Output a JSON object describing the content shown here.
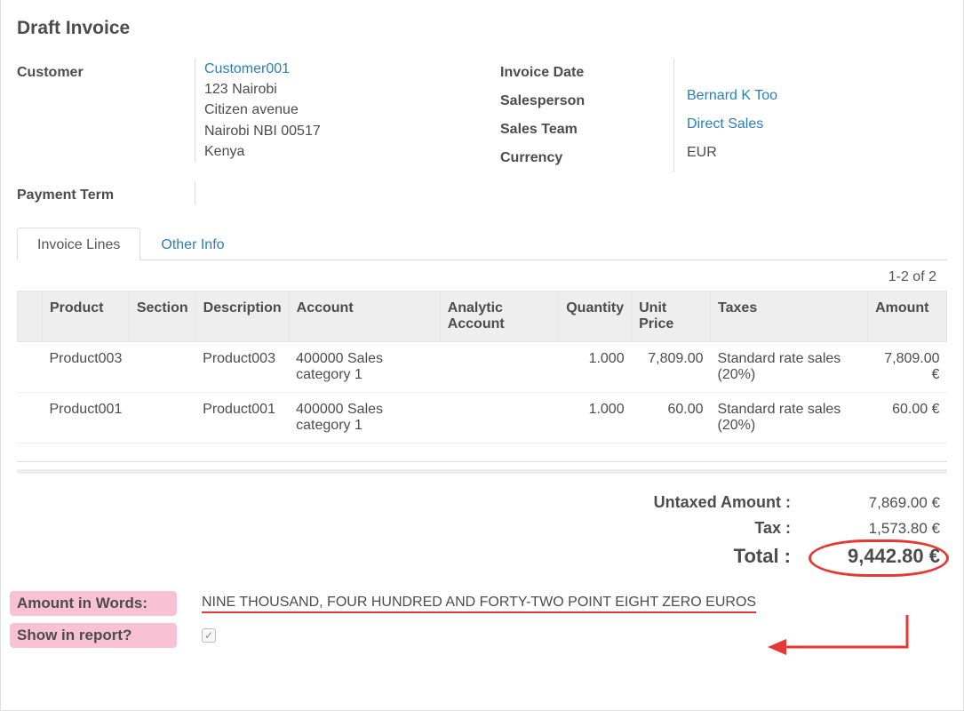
{
  "title": "Draft Invoice",
  "fields": {
    "customer_label": "Customer",
    "payment_term_label": "Payment Term",
    "invoice_date_label": "Invoice Date",
    "salesperson_label": "Salesperson",
    "sales_team_label": "Sales Team",
    "currency_label": "Currency"
  },
  "customer": {
    "name": "Customer001",
    "address1": "123 Nairobi",
    "address2": "Citizen avenue",
    "address3": "Nairobi NBI 00517",
    "country": "Kenya"
  },
  "info": {
    "invoice_date": "",
    "salesperson": "Bernard K Too",
    "sales_team": "Direct Sales",
    "currency": "EUR"
  },
  "tabs": {
    "invoice_lines": "Invoice Lines",
    "other_info": "Other Info"
  },
  "pager": "1-2 of 2",
  "columns": {
    "product": "Product",
    "section": "Section",
    "description": "Description",
    "account": "Account",
    "analytic_account": "Analytic Account",
    "quantity": "Quantity",
    "unit_price": "Unit Price",
    "taxes": "Taxes",
    "amount": "Amount"
  },
  "lines": [
    {
      "product": "Product003",
      "section": "",
      "description": "Product003",
      "account": "400000 Sales category 1",
      "analytic_account": "",
      "quantity": "1.000",
      "unit_price": "7,809.00",
      "taxes": "Standard rate sales (20%)",
      "amount": "7,809.00 €"
    },
    {
      "product": "Product001",
      "section": "",
      "description": "Product001",
      "account": "400000 Sales category 1",
      "analytic_account": "",
      "quantity": "1.000",
      "unit_price": "60.00",
      "taxes": "Standard rate sales (20%)",
      "amount": "60.00 €"
    }
  ],
  "totals": {
    "untaxed_label": "Untaxed Amount :",
    "untaxed_value": "7,869.00 €",
    "tax_label": "Tax :",
    "tax_value": "1,573.80 €",
    "total_label": "Total :",
    "total_value": "9,442.80 €"
  },
  "footer": {
    "amount_words_label": "Amount in Words:",
    "amount_words_value": "NINE THOUSAND, FOUR HUNDRED AND FORTY-TWO POINT EIGHT ZERO EUROS",
    "show_report_label": "Show in report?",
    "show_report_checked": true
  }
}
